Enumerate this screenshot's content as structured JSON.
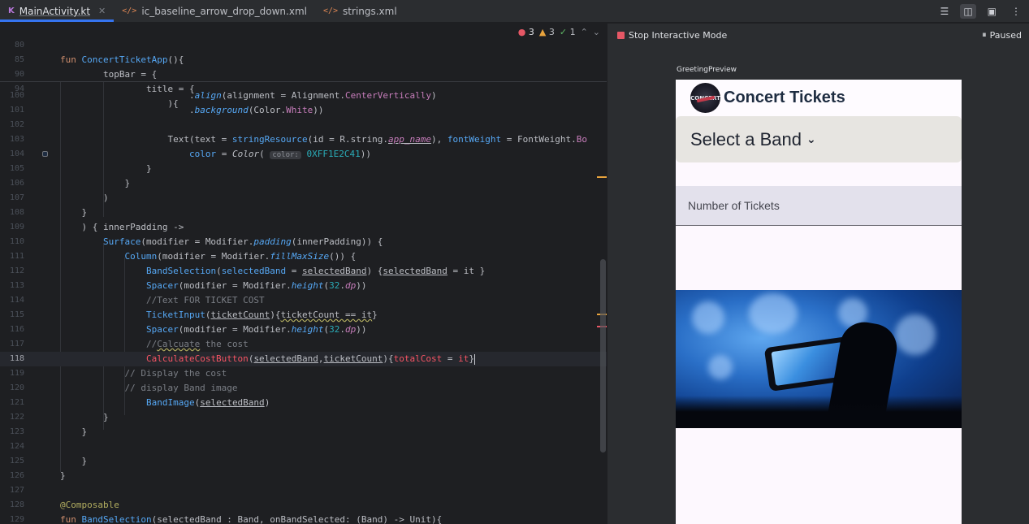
{
  "tabs": [
    {
      "label": "MainActivity.kt",
      "type": "kt",
      "active": true
    },
    {
      "label": "ic_baseline_arrow_drop_down.xml",
      "type": "xml",
      "active": false
    },
    {
      "label": "strings.xml",
      "type": "xml",
      "active": false
    }
  ],
  "toolbar_icons": [
    "menu-icon",
    "split-view-icon",
    "preview-icon",
    "more-icon"
  ],
  "inspections": {
    "errors": "3",
    "warnings": "3",
    "ok": "1"
  },
  "editor": {
    "sticky_lines": [
      {
        "num": "80",
        "text": "fun ConcertTicketApp(){"
      },
      {
        "num": "85",
        "text": "        topBar = {"
      },
      {
        "num": "90",
        "text": "                title = {"
      },
      {
        "num": "94",
        "text": "                    ){"
      }
    ],
    "lines": [
      {
        "num": "100",
        "text": "                        .align(alignment = Alignment.CenterVertically)"
      },
      {
        "num": "101",
        "text": "                        .background(Color.White))"
      },
      {
        "num": "102",
        "text": ""
      },
      {
        "num": "103",
        "text": "                    Text(text = stringResource(id = R.string.app_name), fontWeight = FontWeight.Bo"
      },
      {
        "num": "104",
        "text": "                        color = Color( color: 0XFF1E2C41))"
      },
      {
        "num": "105",
        "text": "                }"
      },
      {
        "num": "106",
        "text": "            }"
      },
      {
        "num": "107",
        "text": "        )"
      },
      {
        "num": "108",
        "text": "    }"
      },
      {
        "num": "109",
        "text": ") { innerPadding ->"
      },
      {
        "num": "110",
        "text": "    Surface(modifier = Modifier.padding(innerPadding)) {"
      },
      {
        "num": "111",
        "text": "        Column(modifier = Modifier.fillMaxSize()) {"
      },
      {
        "num": "112",
        "text": "            BandSelection(selectedBand = selectedBand) {selectedBand = it }"
      },
      {
        "num": "113",
        "text": "            Spacer(modifier = Modifier.height(32.dp))"
      },
      {
        "num": "114",
        "text": "            //Text FOR TICKET COST"
      },
      {
        "num": "115",
        "text": "            TicketInput(ticketCount){ticketCount == it}"
      },
      {
        "num": "116",
        "text": "            Spacer(modifier = Modifier.height(32.dp))"
      },
      {
        "num": "117",
        "text": "            //Calcuate the cost"
      },
      {
        "num": "118",
        "text": "            CalculateCostButton(selectedBand,ticketCount){totalCost = it}"
      },
      {
        "num": "119",
        "text": "            // Display the cost"
      },
      {
        "num": "120",
        "text": "            // display Band image"
      },
      {
        "num": "121",
        "text": "            BandImage(selectedBand)"
      },
      {
        "num": "122",
        "text": "        }"
      },
      {
        "num": "123",
        "text": "    }"
      },
      {
        "num": "124",
        "text": ""
      },
      {
        "num": "125",
        "text": "    }"
      },
      {
        "num": "126",
        "text": "}"
      },
      {
        "num": "127",
        "text": ""
      },
      {
        "num": "128",
        "text": "@Composable"
      },
      {
        "num": "129",
        "text": "fun BandSelection(selectedBand : Band, onBandSelected: (Band) -> Unit){"
      }
    ]
  },
  "preview": {
    "stop_label": "Stop Interactive Mode",
    "paused_label": "Paused",
    "preview_name": "GreetingPreview",
    "app": {
      "title": "Concert Tickets",
      "band_select_label": "Select a Band",
      "tickets_label": "Number of Tickets",
      "logo_text": "CONCERT"
    }
  },
  "colors": {
    "accent": "#3574f0",
    "error": "#e55765",
    "warning": "#e8a33d",
    "ok": "#5fb865",
    "app_title": "#1e2c41"
  }
}
